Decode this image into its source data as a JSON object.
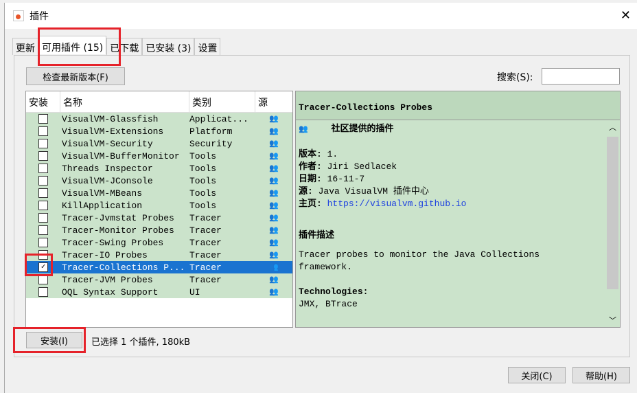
{
  "window": {
    "title": "插件",
    "close": "✕"
  },
  "tabs": [
    {
      "label": "更新"
    },
    {
      "label": "可用插件 (15)"
    },
    {
      "label": "已下载"
    },
    {
      "label": "已安装 (3)"
    },
    {
      "label": "设置"
    }
  ],
  "check_button": "检查最新版本(F)",
  "search": {
    "label": "搜索(S):",
    "value": ""
  },
  "columns": [
    "安装",
    "名称",
    "类别",
    "源"
  ],
  "rows": [
    {
      "name": "VisualVM-Glassfish",
      "category": "Applicat...",
      "checked": false
    },
    {
      "name": "VisualVM-Extensions",
      "category": "Platform",
      "checked": false
    },
    {
      "name": "VisualVM-Security",
      "category": "Security",
      "checked": false
    },
    {
      "name": "VisualVM-BufferMonitor",
      "category": "Tools",
      "checked": false
    },
    {
      "name": "Threads Inspector",
      "category": "Tools",
      "checked": false
    },
    {
      "name": "VisualVM-JConsole",
      "category": "Tools",
      "checked": false
    },
    {
      "name": "VisualVM-MBeans",
      "category": "Tools",
      "checked": false
    },
    {
      "name": "KillApplication",
      "category": "Tools",
      "checked": false
    },
    {
      "name": "Tracer-Jvmstat Probes",
      "category": "Tracer",
      "checked": false
    },
    {
      "name": "Tracer-Monitor Probes",
      "category": "Tracer",
      "checked": false
    },
    {
      "name": "Tracer-Swing Probes",
      "category": "Tracer",
      "checked": false
    },
    {
      "name": "Tracer-IO Probes",
      "category": "Tracer",
      "checked": false
    },
    {
      "name": "Tracer-Collections P...",
      "category": "Tracer",
      "checked": true,
      "selected": true
    },
    {
      "name": "Tracer-JVM Probes",
      "category": "Tracer",
      "checked": false
    },
    {
      "name": "OQL Syntax Support",
      "category": "UI",
      "checked": false
    }
  ],
  "source_icon": "community-icon",
  "detail": {
    "title": "Tracer-Collections Probes",
    "provider": "社区提供的插件",
    "version_label": "版本:",
    "version": "1.",
    "author_label": "作者:",
    "author": "Jiri Sedlacek",
    "date_label": "日期:",
    "date": "16-11-7",
    "source_label": "源:",
    "source": "Java VisualVM 插件中心",
    "home_label": "主页:",
    "home": "https://visualvm.github.io",
    "desc_heading": "插件描述",
    "desc": "Tracer probes to monitor the Java Collections framework.",
    "tech_heading": "Technologies:",
    "tech": "JMX, BTrace"
  },
  "install_button": "安装(I)",
  "status": "已选择 1 个插件, 180kB",
  "close_button": "关闭(C)",
  "help_button": "帮助(H)",
  "colors": {
    "row_bg": "#cbe3cb",
    "selected": "#1a73d0",
    "highlight": "#e5222a"
  }
}
